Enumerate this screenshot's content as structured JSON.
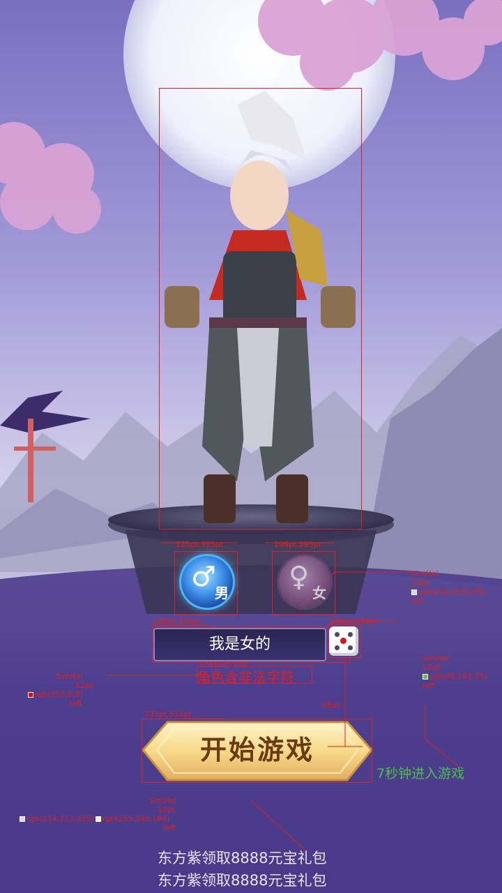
{
  "annotations": {
    "character_box": {
      "male_pos": "125pt,395pt",
      "female_pos": "196pt,395pt"
    },
    "name_box_pos": "108pt,449pt",
    "dice_pos": "236pt,449pt",
    "error_pos": "142pt,479pt",
    "start_pos": "102pt,515pt",
    "start_side": "68pt",
    "spec_gender": {
      "font": "SimHei",
      "size": "14pt",
      "color": "rgb(214,213,235)",
      "align": "left"
    },
    "spec_countdown": {
      "font": "SimHei",
      "size": "12pt",
      "color": "rgb(99,192,75)",
      "align": "left"
    },
    "spec_error": {
      "font": "SimHei",
      "size": "12pt",
      "color": "rgb(255,0,0)",
      "align": "left"
    },
    "spec_promo": {
      "font": "SimHei",
      "size": "15pt",
      "color1": "rgb(214,213,235)",
      "color2": "rgb(255,246,184)",
      "align": "left"
    }
  },
  "gender": {
    "male_label": "男",
    "female_label": "女",
    "selected": "male"
  },
  "name_input": {
    "value": "我是女的"
  },
  "error_message": "角色含非法字符",
  "start_button": {
    "label": "开始游戏"
  },
  "countdown_text": "7秒钟进入游戏",
  "promo": {
    "line1": "东方紫领取8888元宝礼包",
    "line2": "东方紫领取8888元宝礼包"
  },
  "colors": {
    "error": "#ff0000",
    "countdown": "#63c04b",
    "promo_text": "#d6d5eb",
    "promo_accent": "#fff6b8"
  }
}
